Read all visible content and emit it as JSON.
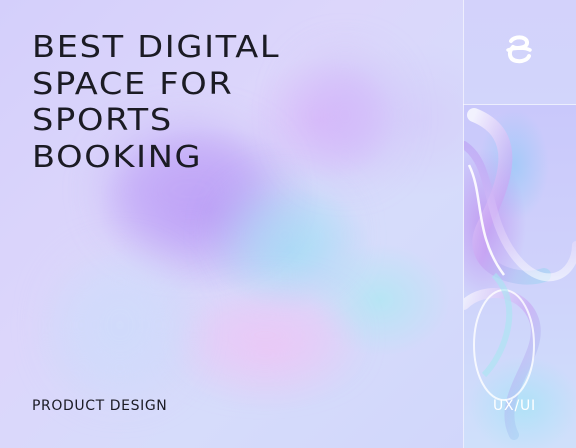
{
  "headline": {
    "lines": [
      "BEST DIGITAL",
      "SPACE FOR",
      "SPORTS",
      "BOOKING"
    ]
  },
  "footer": {
    "left_label": "PRODUCT DESIGN",
    "right_label": "UX/UI"
  },
  "logo": {
    "icon": "brand-logo-icon"
  },
  "colors": {
    "text_dark": "#1b1b24",
    "text_light": "#ffffff",
    "background": "#d7d8fb",
    "accent_purple": "#b998f5",
    "accent_cyan": "#a0e6f5"
  }
}
